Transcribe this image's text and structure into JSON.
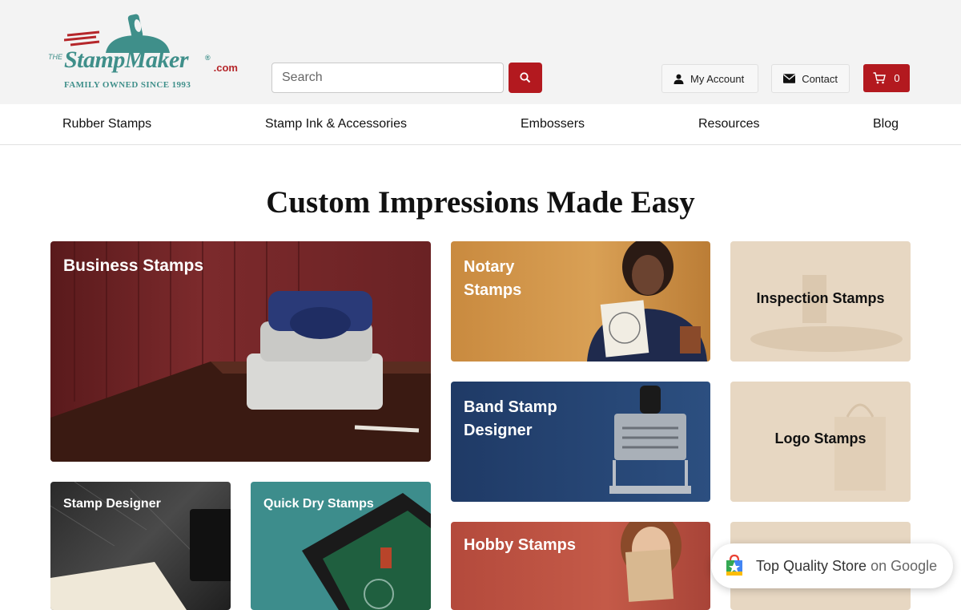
{
  "logo": {
    "prefix": "THE",
    "name": "StampMaker",
    "reg": "®",
    "suffix": ".com",
    "tagline": "FAMILY OWNED SINCE 1993"
  },
  "search": {
    "placeholder": "Search"
  },
  "header_buttons": {
    "account": "My Account",
    "contact": "Contact",
    "cart_count": "0"
  },
  "nav": [
    "Rubber Stamps",
    "Stamp Ink & Accessories",
    "Embossers",
    "Resources",
    "Blog"
  ],
  "page_title": "Custom Impressions Made Easy",
  "tiles": {
    "business": "Business Stamps",
    "notary_line1": "Notary",
    "notary_line2": "Stamps",
    "inspection": "Inspection Stamps",
    "band_line1": "Band Stamp",
    "band_line2": "Designer",
    "logo": "Logo Stamps",
    "designer": "Stamp Designer",
    "quickdry": "Quick Dry Stamps",
    "hobby": "Hobby Stamps"
  },
  "badge": {
    "main": "Top Quality Store",
    "suffix": "on Google"
  },
  "colors": {
    "brand_teal": "#3f8f8a",
    "brand_red": "#b3191f"
  }
}
